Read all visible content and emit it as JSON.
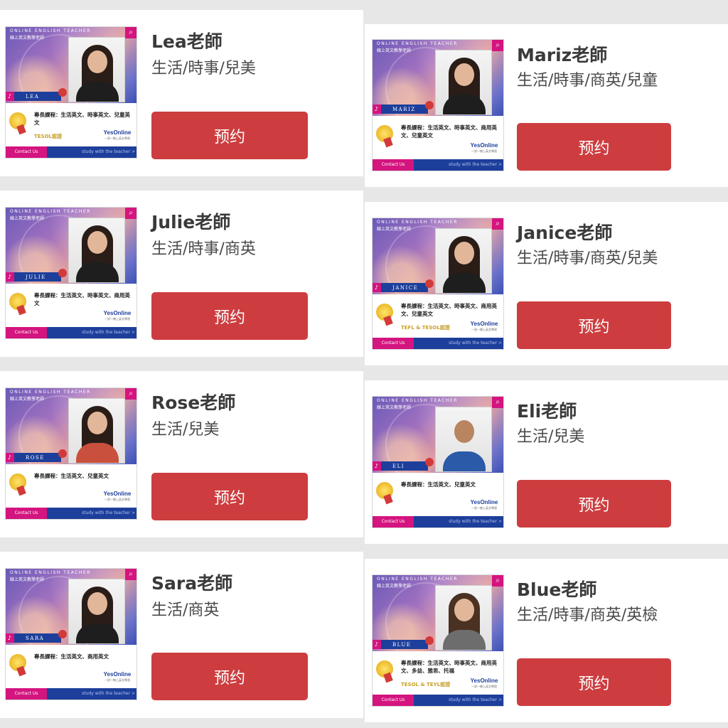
{
  "banner": {
    "online_en": "ONLINE ENGLISH TEACHER",
    "online_zh": "線上英文教學老師",
    "specialty_prefix": "專長課程：",
    "contact": "Contact Us",
    "study": "study with the teacher >",
    "brand": "YesOnline",
    "brand_sub": "一對一線上英文學習"
  },
  "book_label": "预约",
  "teachers": [
    {
      "name": "Lea老師",
      "subjects": "生活/時事/兒美",
      "banner_name": "LEA",
      "courses": "生活英文、時事英文、兒童英文",
      "cert": "TESOL認證"
    },
    {
      "name": "Mariz老師",
      "subjects": "生活/時事/商英/兒童",
      "banner_name": "MARIZ",
      "courses": "生活英文、時事英文、商用英文、兒童英文",
      "cert": ""
    },
    {
      "name": "Julie老師",
      "subjects": "生活/時事/商英",
      "banner_name": "JULIE",
      "courses": "生活英文、時事英文、商用英文",
      "cert": ""
    },
    {
      "name": "Janice老師",
      "subjects": "生活/時事/商英/兒美",
      "banner_name": "JANICE",
      "courses": "生活英文、時事英文、商用英文、兒童英文",
      "cert": "TEFL & TESOL認證"
    },
    {
      "name": "Rose老師",
      "subjects": "生活/兒美",
      "banner_name": "ROSE",
      "courses": "生活英文、兒童英文",
      "cert": ""
    },
    {
      "name": "Eli老師",
      "subjects": "生活/兒美",
      "banner_name": "ELI",
      "courses": "生活英文、兒童英文",
      "cert": ""
    },
    {
      "name": "Sara老師",
      "subjects": "生活/商英",
      "banner_name": "SARA",
      "courses": "生活英文、商用英文",
      "cert": ""
    },
    {
      "name": "Blue老師",
      "subjects": "生活/時事/商英/英檢",
      "banner_name": "BLUE",
      "courses": "生活英文、時事英文、商用英文、多益、雅思、托福",
      "cert": "TESOL & TEYL認證"
    }
  ]
}
